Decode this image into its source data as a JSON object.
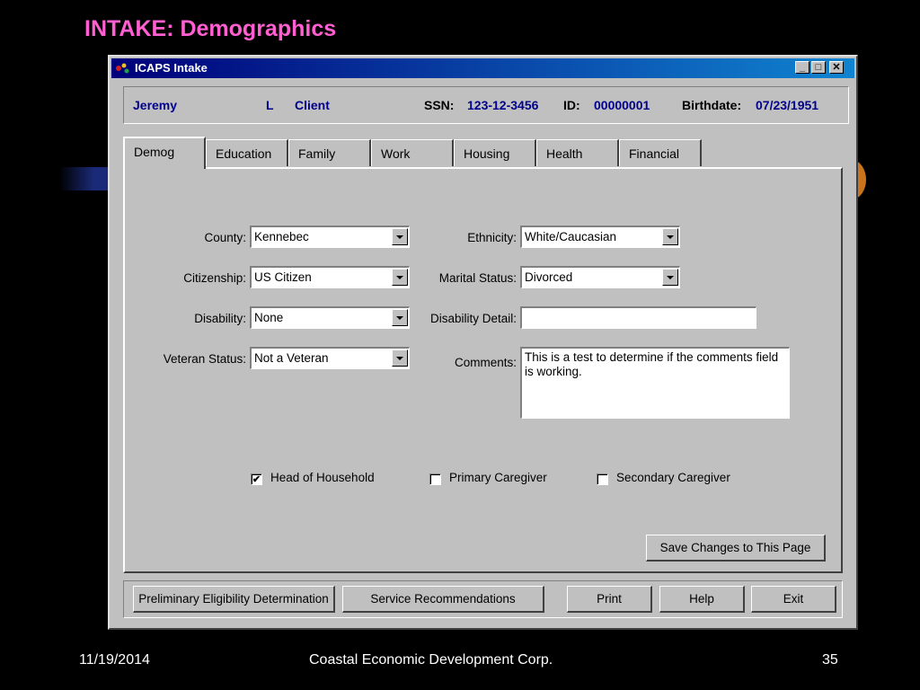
{
  "slide": {
    "title": "INTAKE: Demographics",
    "footer_date": "11/19/2014",
    "footer_org": "Coastal Economic Development Corp.",
    "footer_page": "35"
  },
  "window": {
    "title": "ICAPS Intake",
    "minimize_glyph": "_",
    "maximize_glyph": "□",
    "close_glyph": "✕"
  },
  "client": {
    "first_name": "Jeremy",
    "middle_initial": "L",
    "last_name": "Client",
    "ssn_label": "SSN:",
    "ssn": "123-12-3456",
    "id_label": "ID:",
    "id": "00000001",
    "birthdate_label": "Birthdate:",
    "birthdate": "07/23/1951"
  },
  "tabs": [
    {
      "label": "Demog",
      "active": true
    },
    {
      "label": "Education"
    },
    {
      "label": "Family"
    },
    {
      "label": "Work"
    },
    {
      "label": "Housing"
    },
    {
      "label": "Health"
    },
    {
      "label": "Financial"
    }
  ],
  "form": {
    "county_label": "County:",
    "county_value": "Kennebec",
    "citizenship_label": "Citizenship:",
    "citizenship_value": "US Citizen",
    "disability_label": "Disability:",
    "disability_value": "None",
    "veteran_label": "Veteran Status:",
    "veteran_value": "Not a Veteran",
    "ethnicity_label": "Ethnicity:",
    "ethnicity_value": "White/Caucasian",
    "marital_label": "Marital Status:",
    "marital_value": "Divorced",
    "disability_detail_label": "Disability Detail:",
    "disability_detail_value": "",
    "comments_label": "Comments:",
    "comments_value": "This is a test to determine if the comments field is working."
  },
  "checkboxes": {
    "head_of_household": {
      "label": "Head of Household",
      "checked": true,
      "mark": "✔"
    },
    "primary_caregiver": {
      "label": "Primary Caregiver",
      "checked": false
    },
    "secondary_caregiver": {
      "label": "Secondary Caregiver",
      "checked": false
    }
  },
  "buttons": {
    "save": "Save Changes to This Page",
    "eligibility": "Preliminary Eligibility Determination",
    "recommendations": "Service Recommendations",
    "print": "Print",
    "help": "Help",
    "exit": "Exit"
  },
  "colors": {
    "title_pink": "#ff5fd0",
    "titlebar_start": "#00007a",
    "titlebar_end": "#1084d0",
    "header_blue": "#00008b",
    "window_gray": "#c0c0c0"
  },
  "icons": [
    "app-icon",
    "minimize-icon",
    "maximize-icon",
    "close-icon",
    "dropdown-arrow-icon",
    "checkmark-icon"
  ]
}
